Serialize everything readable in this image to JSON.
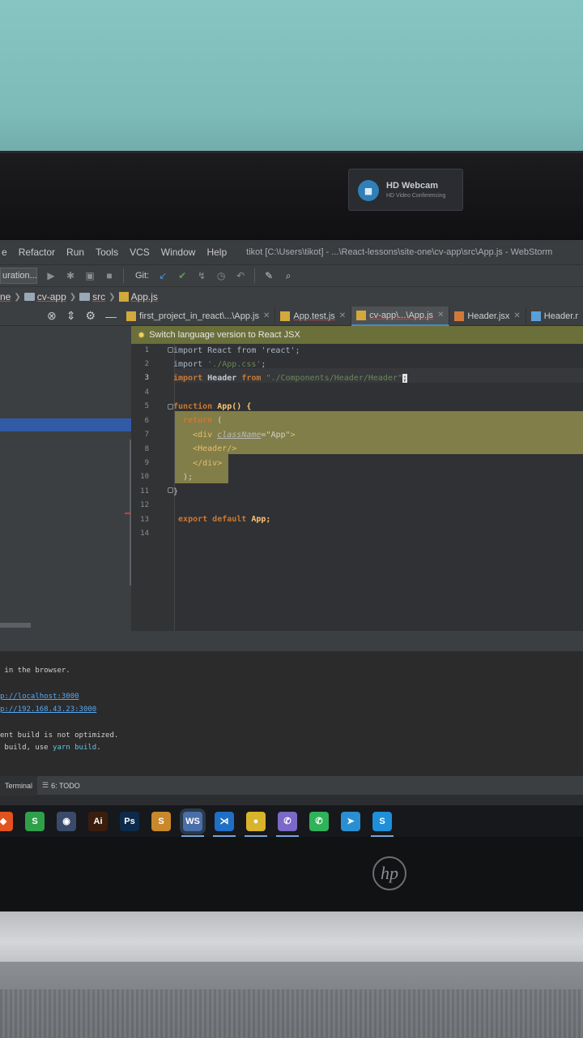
{
  "webcam": {
    "title": "HD Webcam",
    "subtitle": "HD Video Conferencing"
  },
  "menu": {
    "items": [
      "e",
      "Refactor",
      "Run",
      "Tools",
      "VCS",
      "Window",
      "Help"
    ],
    "window_title": "tikot [C:\\Users\\tikot] - ...\\React-lessons\\site-one\\cv-app\\src\\App.js - WebStorm"
  },
  "toolbar": {
    "run_config": "uration...",
    "git_label": "Git:"
  },
  "breadcrumb": [
    "ne",
    "cv-app",
    "src",
    "App.js"
  ],
  "tabs": [
    {
      "label": "first_project_in_react\\...\\App.js",
      "active": false
    },
    {
      "label": "App.test.js",
      "active": false
    },
    {
      "label": "cv-app\\...\\App.js",
      "active": true
    },
    {
      "label": "Header.jsx",
      "active": false
    },
    {
      "label": "Header.r",
      "active": false
    }
  ],
  "banner": {
    "text": "Switch language version to React JSX"
  },
  "editor": {
    "line_numbers": [
      "1",
      "2",
      "3",
      "4",
      "5",
      "6",
      "7",
      "8",
      "9",
      "10",
      "11",
      "12",
      "13",
      "14"
    ],
    "lines": {
      "l1": "import React from 'react';",
      "l2_kw": "import",
      "l2_str": "'./App.css'",
      "l2_end": ";",
      "l3_kw": "import",
      "l3_id": "Header",
      "l3_from": "from",
      "l3_str": "\"./Components/Header/Header\"",
      "l3_end": ";",
      "l5_kw": "function",
      "l5_id": "App() {",
      "l6_kw": "return",
      "l6_paren": " (",
      "l7_open": "<div",
      "l7_attr": "className",
      "l7_eq": "=",
      "l7_val": "\"App\"",
      "l7_close": ">",
      "l8": "<Header/>",
      "l9": "</div>",
      "l10": ");",
      "l11": "}",
      "l13_kw": "export default",
      "l13_id": "App;"
    }
  },
  "terminal": {
    "lines": [
      " in the browser.",
      "",
      "p://localhost:3000",
      "p://192.168.43.23:3000",
      "",
      "ent build is not optimized.",
      " build, use "
    ],
    "cmd": "yarn build",
    "cmd_suffix": "."
  },
  "bottom_tabs": [
    {
      "label": "Terminal"
    },
    {
      "label": "6: TODO"
    }
  ],
  "taskbar": {
    "apps": [
      {
        "name": "brave",
        "glyph": "◆",
        "color": "#e3531f"
      },
      {
        "name": "s-app",
        "glyph": "S",
        "color": "#2fa04a"
      },
      {
        "name": "resolve",
        "glyph": "◉",
        "color": "#3a4a6a"
      },
      {
        "name": "illustrator",
        "glyph": "Ai",
        "color": "#3b1d0d"
      },
      {
        "name": "photoshop",
        "glyph": "Ps",
        "color": "#0d2a4a"
      },
      {
        "name": "sublime",
        "glyph": "S",
        "color": "#c9882a"
      },
      {
        "name": "webstorm",
        "glyph": "WS",
        "color": "#4a6fa8"
      },
      {
        "name": "vscode",
        "glyph": "⋊",
        "color": "#1f6fc6"
      },
      {
        "name": "chrome",
        "glyph": "●",
        "color": "#d8b42a"
      },
      {
        "name": "viber",
        "glyph": "✆",
        "color": "#7b68c8"
      },
      {
        "name": "whatsapp",
        "glyph": "✆",
        "color": "#2fb25a"
      },
      {
        "name": "telegram",
        "glyph": "➤",
        "color": "#2a8fd2"
      },
      {
        "name": "skype",
        "glyph": "S",
        "color": "#1e8fd8"
      }
    ]
  }
}
